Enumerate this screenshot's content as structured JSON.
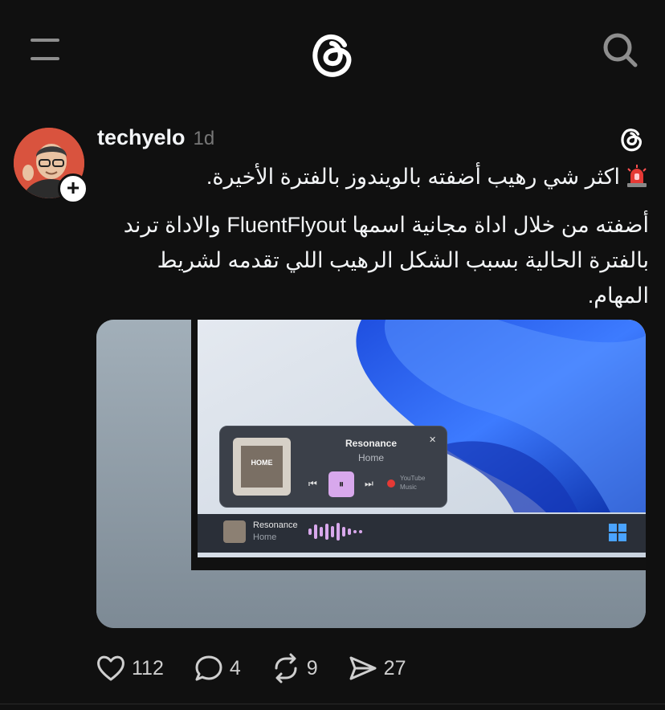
{
  "nav": {
    "menu_icon": "hamburger-menu-icon",
    "logo_icon": "threads-logo-icon",
    "search_icon": "search-icon"
  },
  "post": {
    "username": "techyelo",
    "timestamp": "1d",
    "line1": "اكثر شي رهيب أضفته بالويندوز بالفترة الأخيرة.",
    "paragraph": "أضفته من خلال اداة مجانية اسمها FluentFlyout والاداة ترند بالفترة الحالية بسبب الشكل الرهيب اللي تقدمه لشريط المهام.",
    "emoji_icon": "police-light-emoji",
    "media": {
      "flyout_title": "Resonance",
      "flyout_subtitle": "Home",
      "album_text": "HOME",
      "source_label_1": "YouTube",
      "source_label_2": "Music",
      "taskbar_title": "Resonance",
      "taskbar_subtitle": "Home",
      "close_glyph": "✕"
    },
    "actions": {
      "likes": "112",
      "replies": "4",
      "reposts": "9",
      "shares": "27"
    }
  },
  "colors": {
    "background": "#101010",
    "text": "#f3f5f7",
    "muted": "#777777",
    "accent_pause": "#d8a8ec"
  }
}
